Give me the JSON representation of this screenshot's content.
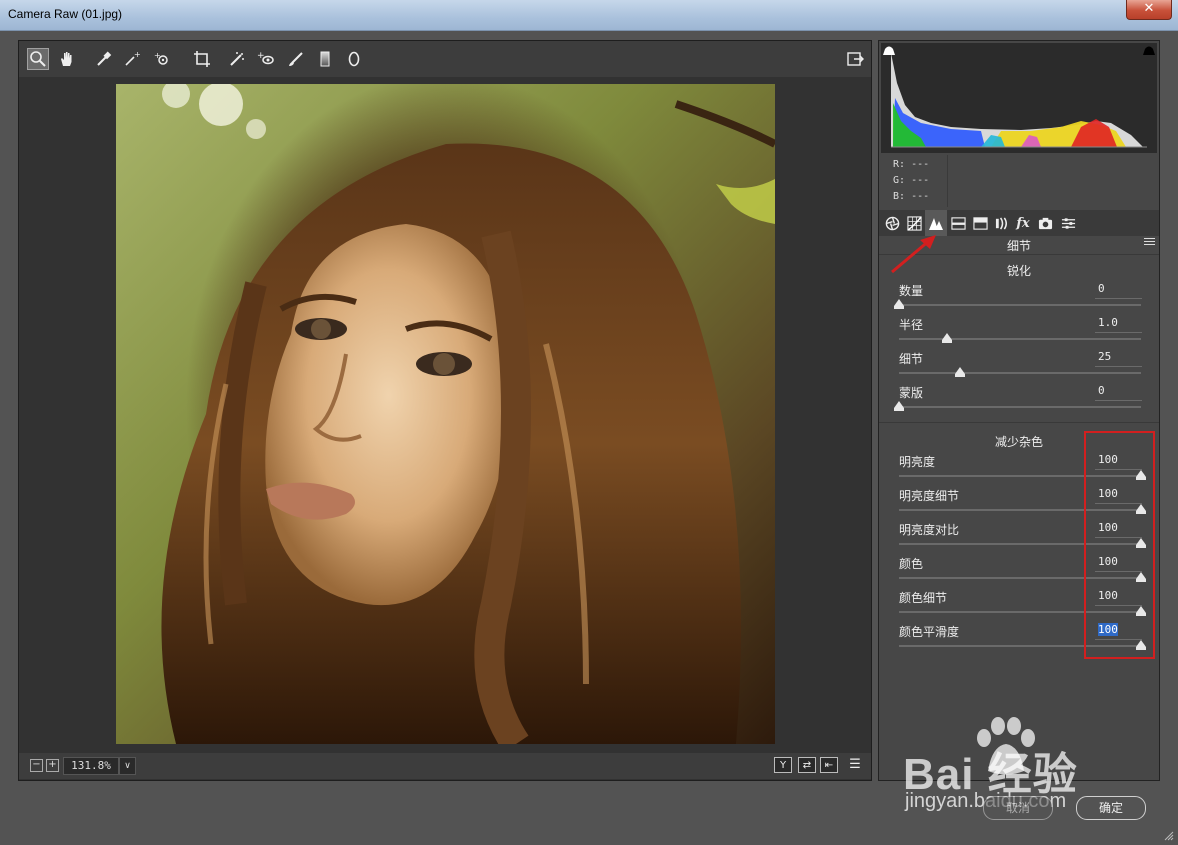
{
  "window": {
    "title": "Camera Raw (01.jpg)",
    "close_label": "✕"
  },
  "toolbar": {
    "tools": [
      "zoom-tool-icon",
      "hand-tool-icon",
      "white-balance-tool-icon",
      "color-sampler-tool-icon",
      "targeted-adjustment-tool-icon",
      "crop-tool-icon",
      "straighten-tool-icon",
      "spot-removal-tool-icon",
      "red-eye-tool-icon",
      "adjustment-brush-icon",
      "graduated-filter-icon",
      "radial-filter-icon"
    ],
    "active_tool": "zoom-tool-icon"
  },
  "bottom_bar": {
    "zoom_out": "−",
    "zoom_in": "+",
    "zoom_level": "131.8%",
    "zoom_drop": "∨",
    "buttons": [
      "Y",
      "⇄",
      "⇤",
      "☰"
    ]
  },
  "histogram": {
    "r_label": "R:",
    "r_value": "---",
    "g_label": "G:",
    "g_value": "---",
    "b_label": "B:",
    "b_value": "---"
  },
  "panel": {
    "title": "细节",
    "active_tab": "detail-tab-icon",
    "sharpen": {
      "title": "锐化",
      "sliders": [
        {
          "label": "数量",
          "value": "0",
          "level": 0
        },
        {
          "label": "半径",
          "value": "1.0",
          "level": 0.2
        },
        {
          "label": "细节",
          "value": "25",
          "level": 0.25
        },
        {
          "label": "蒙版",
          "value": "0",
          "level": 0
        }
      ]
    },
    "noise_reduction": {
      "title": "减少杂色",
      "sliders": [
        {
          "label": "明亮度",
          "value": "100",
          "level": 1
        },
        {
          "label": "明亮度细节",
          "value": "100",
          "level": 1
        },
        {
          "label": "明亮度对比",
          "value": "100",
          "level": 1
        },
        {
          "label": "颜色",
          "value": "100",
          "level": 1
        },
        {
          "label": "颜色细节",
          "value": "100",
          "level": 1
        },
        {
          "label": "颜色平滑度",
          "value": "100",
          "level": 1
        }
      ]
    }
  },
  "buttons": {
    "cancel": "取消",
    "ok": "确定"
  },
  "watermark": {
    "brand": "Bai  经验",
    "url": "jingyan.baidu.com"
  },
  "colors": {
    "highlight_box": "#d21f1f",
    "selection": "#2f6ac7"
  }
}
